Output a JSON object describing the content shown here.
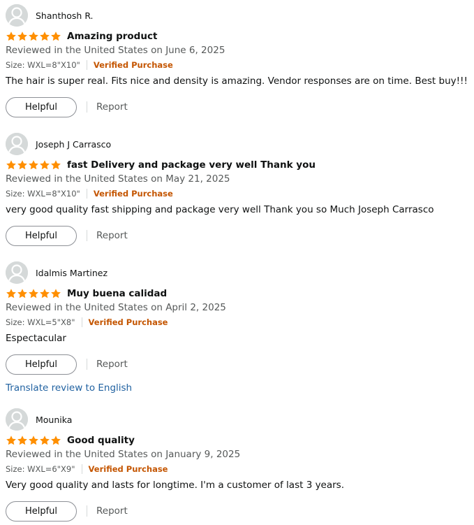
{
  "colors": {
    "star": "#ff8f00",
    "verified": "#c45500",
    "link": "#2162a1",
    "muted": "#565959"
  },
  "avatar_icon": "user-silhouette-icon",
  "review_ui": {
    "helpful_label": "Helpful",
    "report_label": "Report",
    "verified_label": "Verified Purchase",
    "translate_label": "Translate review to English"
  },
  "reviews": [
    {
      "author": "Shanthosh R.",
      "rating": 5,
      "title": "Amazing product",
      "date_line": "Reviewed in the United States on June 6, 2025",
      "variant": "Size: WXL=8\"X10\"",
      "body": "The hair is super real. Fits nice and density is amazing. Vendor responses are on time. Best buy!!!"
    },
    {
      "author": "Joseph J Carrasco",
      "rating": 5,
      "title": "fast Delivery and package very well Thank you",
      "date_line": "Reviewed in the United States on May 21, 2025",
      "variant": "Size: WXL=8\"X10\"",
      "body": "very good quality fast shipping and package very well Thank you so Much Joseph Carrasco"
    },
    {
      "author": "Idalmis Martinez",
      "rating": 5,
      "title": "Muy buena calidad",
      "date_line": "Reviewed in the United States on April 2, 2025",
      "variant": "Size: WXL=5\"X8\"",
      "body": "Espectacular"
    },
    {
      "author": "Mounika",
      "rating": 5,
      "title": "Good quality",
      "date_line": "Reviewed in the United States on January 9, 2025",
      "variant": "Size: WXL=6\"X9\"",
      "body": "Very good quality and lasts for longtime. I'm a customer of last 3 years."
    }
  ]
}
